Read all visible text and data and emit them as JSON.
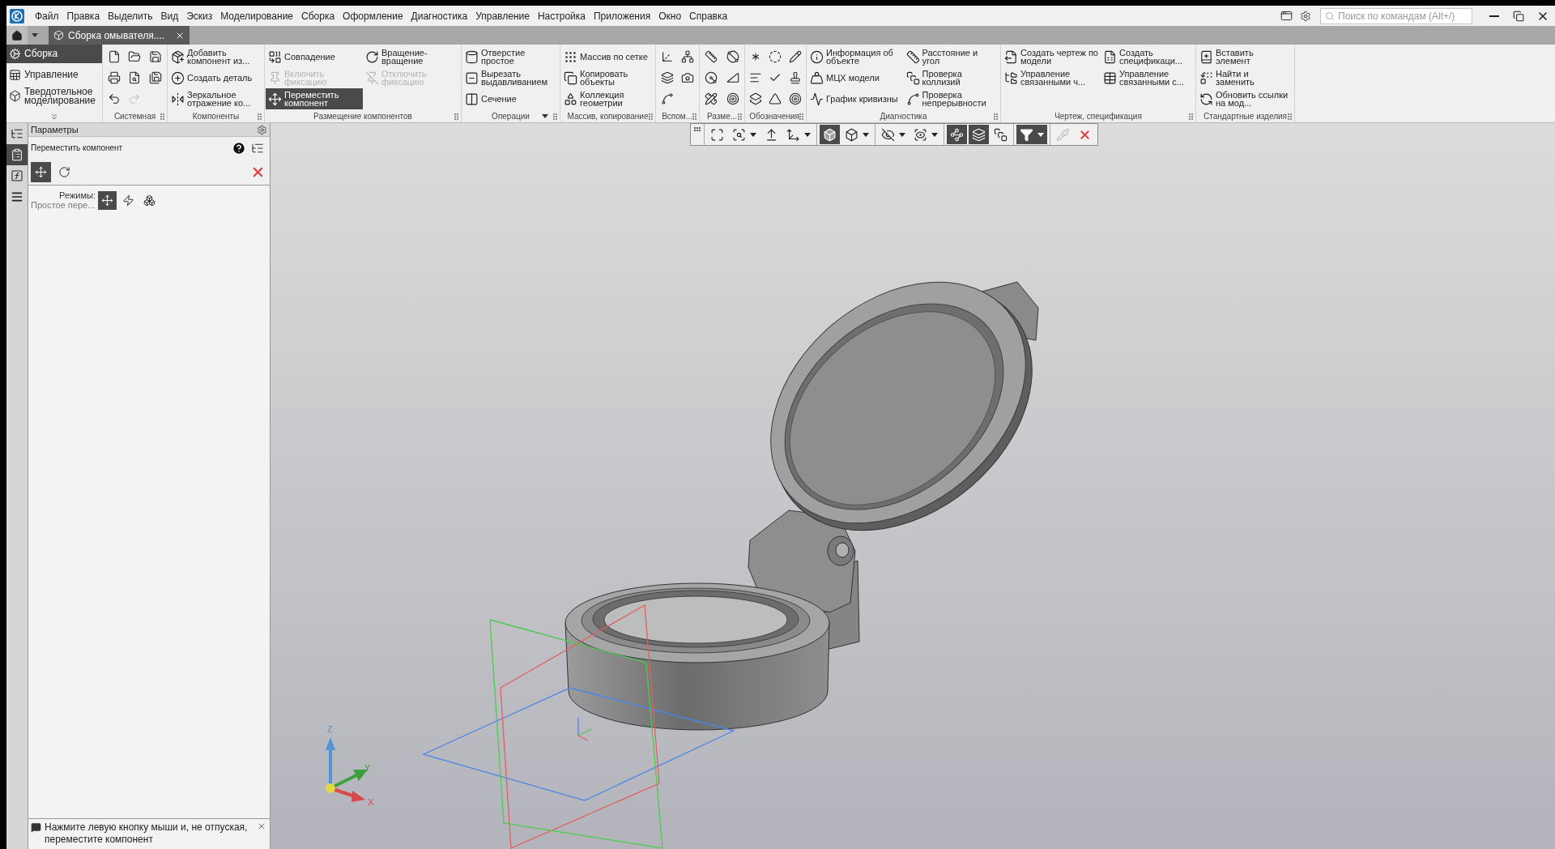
{
  "menu": [
    "Файл",
    "Правка",
    "Выделить",
    "Вид",
    "Эскиз",
    "Моделирование",
    "Сборка",
    "Оформление",
    "Диагностика",
    "Управление",
    "Настройка",
    "Приложения",
    "Окно",
    "Справка"
  ],
  "search": {
    "placeholder": "Поиск по командам (Alt+/)"
  },
  "tabs": [
    {
      "label": "Сборка омывателя....",
      "selected": true
    }
  ],
  "ribbon": {
    "modes": [
      {
        "label": "Сборка",
        "selected": true
      },
      {
        "label": "Управление",
        "selected": false
      },
      {
        "label": "Твердотельное моделирование",
        "selected": false
      }
    ],
    "groups": [
      {
        "title": "Системная",
        "kind": "icons",
        "tools": [
          {
            "disabled": false
          },
          {
            "disabled": false
          },
          {
            "disabled": false
          },
          {
            "disabled": false
          },
          {
            "disabled": false
          },
          {
            "disabled": false
          },
          {
            "disabled": false
          },
          {
            "disabled": true
          }
        ]
      },
      {
        "title": "Компоненты",
        "kind": "commands",
        "columns": [
          [
            {
              "label": "Добавить компонент из..."
            },
            {
              "label": "Создать деталь"
            },
            {
              "label": "Зеркальное отражение ко..."
            }
          ]
        ]
      },
      {
        "title": "Размещение компонентов",
        "kind": "commands",
        "columns": [
          [
            {
              "label": "Совпадение",
              "disabled": false,
              "selected": false
            },
            {
              "label": "Включить фиксацию",
              "disabled": true,
              "selected": false
            },
            {
              "label": "Переместить компонент",
              "disabled": false,
              "selected": true
            }
          ],
          [
            {
              "label": "Вращение-вращение",
              "disabled": false,
              "selected": false
            },
            {
              "label": "Отключить фиксацию",
              "disabled": true,
              "selected": false
            }
          ]
        ]
      },
      {
        "title": "Операции",
        "kind": "commands",
        "title_menu": true,
        "columns": [
          [
            {
              "label": "Отверстие простое"
            },
            {
              "label": "Вырезать выдавливанием"
            },
            {
              "label": "Сечение"
            }
          ]
        ]
      },
      {
        "title": "Массив, копирование",
        "kind": "commands",
        "columns": [
          [
            {
              "label": "Массив по сетке"
            },
            {
              "label": "Копировать объекты"
            },
            {
              "label": "Коллекция геометрии"
            }
          ]
        ]
      },
      {
        "title": "Вспом...",
        "kind": "icons"
      },
      {
        "title": "Разме...",
        "kind": "icons"
      },
      {
        "title": "Обозначения",
        "kind": "icons"
      },
      {
        "title": "Диагностика",
        "kind": "commands",
        "columns": [
          [
            {
              "label": "Информация об объекте"
            },
            {
              "label": "МЦХ модели"
            },
            {
              "label": "График кривизны"
            }
          ],
          [
            {
              "label": "Расстояние и угол"
            },
            {
              "label": "Проверка коллизий"
            },
            {
              "label": "Проверка непрерывности"
            }
          ]
        ]
      },
      {
        "title": "Чертеж, спецификация",
        "kind": "commands",
        "columns": [
          [
            {
              "label": "Создать чертеж по модели"
            },
            {
              "label": "Управление связанными ч..."
            }
          ],
          [
            {
              "label": "Создать спецификаци..."
            },
            {
              "label": "Управление связанными с..."
            }
          ]
        ]
      },
      {
        "title": "Стандартные изделия",
        "kind": "commands",
        "columns": [
          [
            {
              "label": "Вставить элемент"
            },
            {
              "label": "Найти и заменить"
            },
            {
              "label": "Обновить ссылки на мод..."
            }
          ]
        ]
      }
    ]
  },
  "side_tabs": [
    {
      "selected": false
    },
    {
      "selected": true
    },
    {
      "selected": false
    },
    {
      "selected": false
    }
  ],
  "panel": {
    "title": "Параметры",
    "command": "Переместить компонент",
    "actions": [
      {
        "selected": true
      },
      {
        "selected": false
      }
    ],
    "modes_label": "Режимы:",
    "mode_value": "Простое пере...",
    "modes": [
      {
        "selected": true
      },
      {
        "selected": false
      },
      {
        "selected": false
      }
    ],
    "hint": "Нажмите левую кнопку мыши и, не отпуская, переместите компонент"
  },
  "view_toolbar": [
    [
      {
        "kind": "plain",
        "selected": false,
        "disabled": false
      },
      {
        "kind": "split",
        "selected": false,
        "disabled": false
      },
      {
        "kind": "plain",
        "selected": false,
        "disabled": false
      },
      {
        "kind": "split",
        "selected": false,
        "disabled": false
      }
    ],
    [
      {
        "kind": "plain",
        "selected": true,
        "disabled": false
      },
      {
        "kind": "split",
        "selected": false,
        "disabled": false
      }
    ],
    [
      {
        "kind": "split",
        "selected": false,
        "disabled": false
      },
      {
        "kind": "split",
        "selected": false,
        "disabled": false
      }
    ],
    [
      {
        "kind": "plain",
        "selected": true,
        "disabled": false
      },
      {
        "kind": "plain",
        "selected": true,
        "disabled": false
      },
      {
        "kind": "plain",
        "selected": false,
        "disabled": false
      }
    ],
    [
      {
        "kind": "split",
        "selected": true,
        "disabled": false
      }
    ],
    [
      {
        "kind": "plain",
        "selected": false,
        "disabled": true
      },
      {
        "kind": "plain",
        "selected": false,
        "disabled": false
      }
    ]
  ],
  "viewport": {
    "axes": {
      "x": "X",
      "y": "Y",
      "z": "Z"
    }
  }
}
